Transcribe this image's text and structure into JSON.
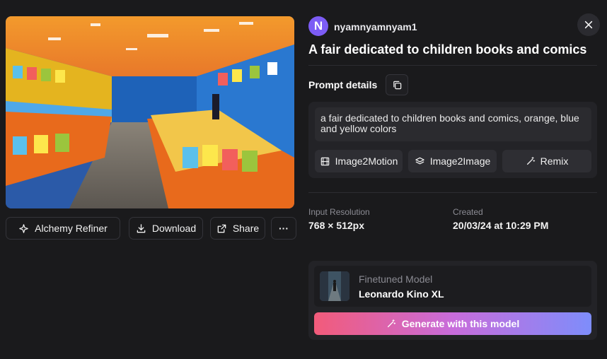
{
  "user": {
    "avatar_initial": "N",
    "name": "nyamnyamnyam1"
  },
  "image": {
    "title": "A fair dedicated to children books and comics"
  },
  "actions": {
    "alchemy_refiner": "Alchemy Refiner",
    "download": "Download",
    "share": "Share",
    "more": "···"
  },
  "prompt": {
    "section_label": "Prompt details",
    "text": "a fair dedicated to children books and comics, orange, blue and yellow colors"
  },
  "tools": {
    "image2motion": "Image2Motion",
    "image2image": "Image2Image",
    "remix": "Remix"
  },
  "meta": {
    "resolution_label": "Input Resolution",
    "resolution_value": "768 × 512px",
    "created_label": "Created",
    "created_value": "20/03/24 at 10:29 PM"
  },
  "model": {
    "label": "Finetuned Model",
    "name": "Leonardo Kino XL",
    "generate_label": "Generate with this model"
  },
  "icons": {
    "close": "close-icon",
    "copy": "copy-icon",
    "alchemy": "alchemy-icon",
    "download": "download-icon",
    "share": "share-icon",
    "image2motion": "film-icon",
    "image2image": "layers-icon",
    "remix": "magic-wand-icon",
    "generate": "magic-wand-icon"
  },
  "colors": {
    "background": "#1a1a1c",
    "panel": "#232327",
    "avatar": "#7c5cf5",
    "gradient_start": "#f25b7a",
    "gradient_end": "#7e8dfb"
  }
}
